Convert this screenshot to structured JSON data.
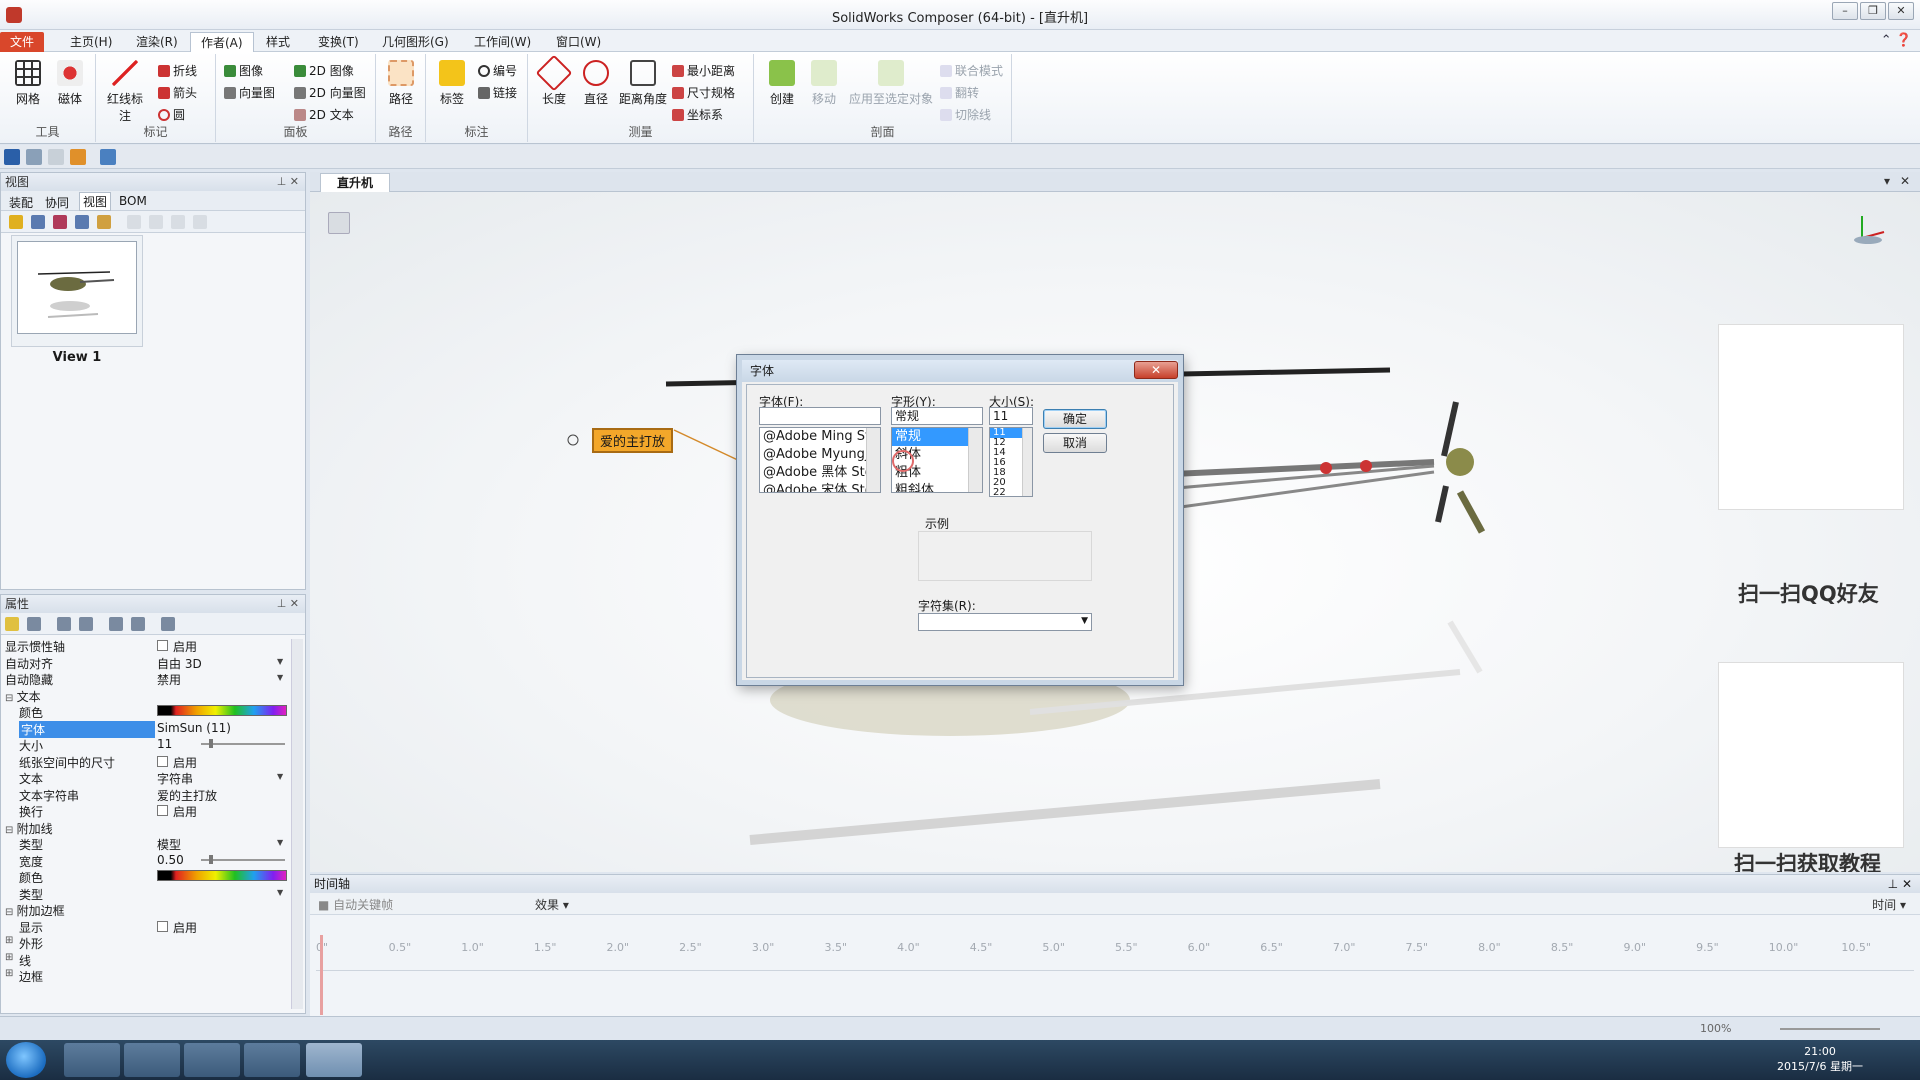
{
  "window": {
    "title": "SolidWorks Composer (64-bit) - [直升机]"
  },
  "menu": {
    "file": "文件",
    "tabs": [
      "主页(H)",
      "渲染(R)",
      "作者(A)",
      "样式",
      "变换(T)",
      "几何图形(G)",
      "工作间(W)",
      "窗口(W)"
    ]
  },
  "ribbon": {
    "groups": {
      "tools": "工具",
      "mark": "标记",
      "panel": "面板",
      "path": "路径",
      "annot": "标注",
      "measure": "测量",
      "section": "剖面"
    },
    "buttons": {
      "grid": "网格",
      "magnet": "磁体",
      "redline": "红线标注",
      "polyline": "折线",
      "arrow": "箭头",
      "circle": "圆",
      "image": "图像",
      "vectorimage": "向量图",
      "img2d": "2D 图像",
      "vec2d": "2D 向量图",
      "text2d": "2D 文本",
      "path": "路径",
      "label": "标签",
      "number": "编号",
      "link": "链接",
      "length": "长度",
      "diameter": "直径",
      "distangle": "距离角度",
      "mindist": "最小距离",
      "dimspec": "尺寸规格",
      "coordsys": "坐标系",
      "create": "创建",
      "move": "移动",
      "applysel": "应用至选定对象",
      "unionmode": "联合模式",
      "flip": "翻转",
      "cutline": "切除线"
    }
  },
  "left_panel": {
    "title": "视图",
    "tabs": [
      "装配",
      "协同",
      "视图",
      "BOM"
    ],
    "thumbnail_label": "View 1"
  },
  "properties": {
    "title": "属性",
    "rows": [
      {
        "key": "显示惯性轴",
        "check": true,
        "value": "启用"
      },
      {
        "key": "自动对齐",
        "value": "自由 3D",
        "dd": true
      },
      {
        "key": "自动隐藏",
        "value": "禁用",
        "dd": true
      },
      {
        "section": "文本"
      },
      {
        "key": "颜色",
        "color": true,
        "indent": true
      },
      {
        "key": "字体",
        "value": "SimSun (11)",
        "indent": true,
        "selected": true
      },
      {
        "key": "大小",
        "value": "11",
        "slider": true,
        "indent": true
      },
      {
        "key": "纸张空间中的尺寸",
        "check": true,
        "value": "启用",
        "indent": true
      },
      {
        "key": "文本",
        "value": "字符串",
        "dd": true,
        "indent": true
      },
      {
        "key": "文本字符串",
        "value": "爱的主打放",
        "indent": true
      },
      {
        "key": "换行",
        "check": true,
        "value": "启用",
        "indent": true
      },
      {
        "section": "附加线"
      },
      {
        "key": "类型",
        "value": "模型",
        "dd": true,
        "indent": true
      },
      {
        "key": "宽度",
        "value": "0.50",
        "slider": true,
        "indent": true
      },
      {
        "key": "颜色",
        "color": true,
        "indent": true
      },
      {
        "key": "类型",
        "dd": true,
        "indent": true
      },
      {
        "section": "附加边框"
      },
      {
        "key": "显示",
        "check": true,
        "value": "启用",
        "indent": true
      },
      {
        "key": "外形",
        "collapsed": true
      },
      {
        "key": "线",
        "collapsed": true
      },
      {
        "key": "边框",
        "collapsed": true
      }
    ]
  },
  "viewport": {
    "tab": "直升机",
    "callout": "爱的主打放"
  },
  "font_dialog": {
    "title": "字体",
    "close": "✕",
    "font_label": "字体(F):",
    "style_label": "字形(Y):",
    "size_label": "大小(S):",
    "font_value": "",
    "style_value": "常规",
    "size_value": "11",
    "fonts": [
      "@Adobe Ming Std",
      "@Adobe Myungjo",
      "@Adobe 黑体 Std",
      "@Adobe 宋体 Std"
    ],
    "styles": [
      "常规",
      "斜体",
      "粗体",
      "粗斜体"
    ],
    "sizes": [
      "11",
      "12",
      "14",
      "16",
      "18",
      "20",
      "22"
    ],
    "ok": "确定",
    "cancel": "取消",
    "sample": "示例",
    "charset": "字符集(R):"
  },
  "timeline": {
    "title": "时间轴",
    "autokey": "自动关键帧",
    "effects": "效果",
    "time_label": "时间",
    "ticks": [
      "0\"",
      "0.5\"",
      "1.0\"",
      "1.5\"",
      "2.0\"",
      "2.5\"",
      "3.0\"",
      "3.5\"",
      "4.0\"",
      "4.5\"",
      "5.0\"",
      "5.5\"",
      "6.0\"",
      "6.5\"",
      "7.0\"",
      "7.5\"",
      "8.0\"",
      "8.5\"",
      "9.0\"",
      "9.5\"",
      "10.0\"",
      "10.5\""
    ]
  },
  "status": {
    "zoom": "100%"
  },
  "qr": {
    "top_caption": "扫一扫QQ好友",
    "bottom_caption": "扫一扫获取教程"
  },
  "taskbar": {
    "time": "21:00",
    "date": "2015/7/6 星期一"
  }
}
